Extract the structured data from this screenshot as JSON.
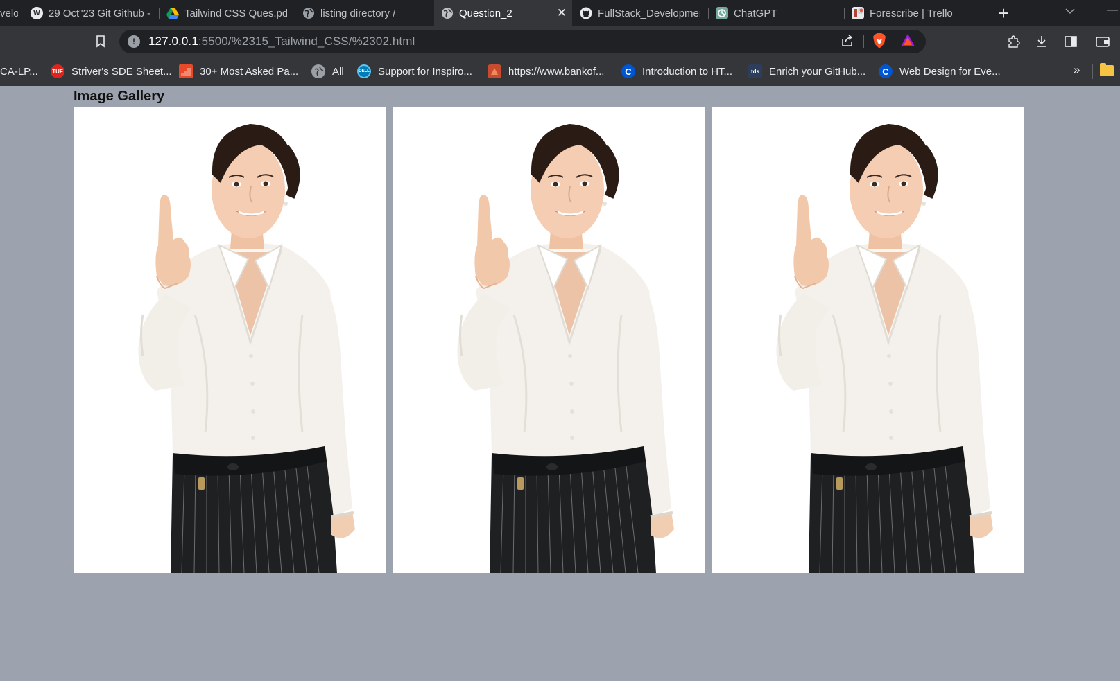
{
  "browser": {
    "tabs": [
      {
        "title": "velo",
        "favicon": "partial",
        "active": false
      },
      {
        "title": "29 Oct\"23 Git Github -",
        "favicon": "wordpress-icon",
        "active": false
      },
      {
        "title": "Tailwind CSS Ques.pdf",
        "favicon": "google-drive-icon",
        "active": false
      },
      {
        "title": "listing directory /",
        "favicon": "globe-icon",
        "active": false
      },
      {
        "title": "Question_2",
        "favicon": "globe-icon",
        "active": true
      },
      {
        "title": "FullStack_Development",
        "favicon": "github-icon",
        "active": false
      },
      {
        "title": "ChatGPT",
        "favicon": "chatgpt-icon",
        "active": false
      },
      {
        "title": "Forescribe | Trello",
        "favicon": "trello-icon",
        "active": false
      }
    ],
    "address_bar": {
      "host": "127.0.0.1",
      "path": ":5500/%2315_Tailwind_CSS/%2302.html"
    },
    "bookmarks": [
      {
        "label": "CA-LP...",
        "icon": "none"
      },
      {
        "label": "Striver's SDE Sheet...",
        "icon": "tuf-icon"
      },
      {
        "label": "30+ Most Asked Pa...",
        "icon": "stairs-icon"
      },
      {
        "label": "All",
        "icon": "globe-icon"
      },
      {
        "label": "Support for Inspiro...",
        "icon": "dell-icon"
      },
      {
        "label": "https://www.bankof...",
        "icon": "bank-icon"
      },
      {
        "label": "Introduction to HT...",
        "icon": "coursera-icon"
      },
      {
        "label": "Enrich your GitHub...",
        "icon": "tds-icon"
      },
      {
        "label": "Web Design for Eve...",
        "icon": "coursera-icon"
      }
    ],
    "bookmarks_overflow": "»"
  },
  "page": {
    "title": "Image Gallery",
    "images": [
      {
        "subject": "woman in white blouse pointing up"
      },
      {
        "subject": "woman in white blouse pointing up"
      },
      {
        "subject": "woman in white blouse pointing up"
      }
    ]
  },
  "colors": {
    "page_background": "#9ca3af",
    "tab_strip": "#202124",
    "toolbar": "#35363a"
  }
}
